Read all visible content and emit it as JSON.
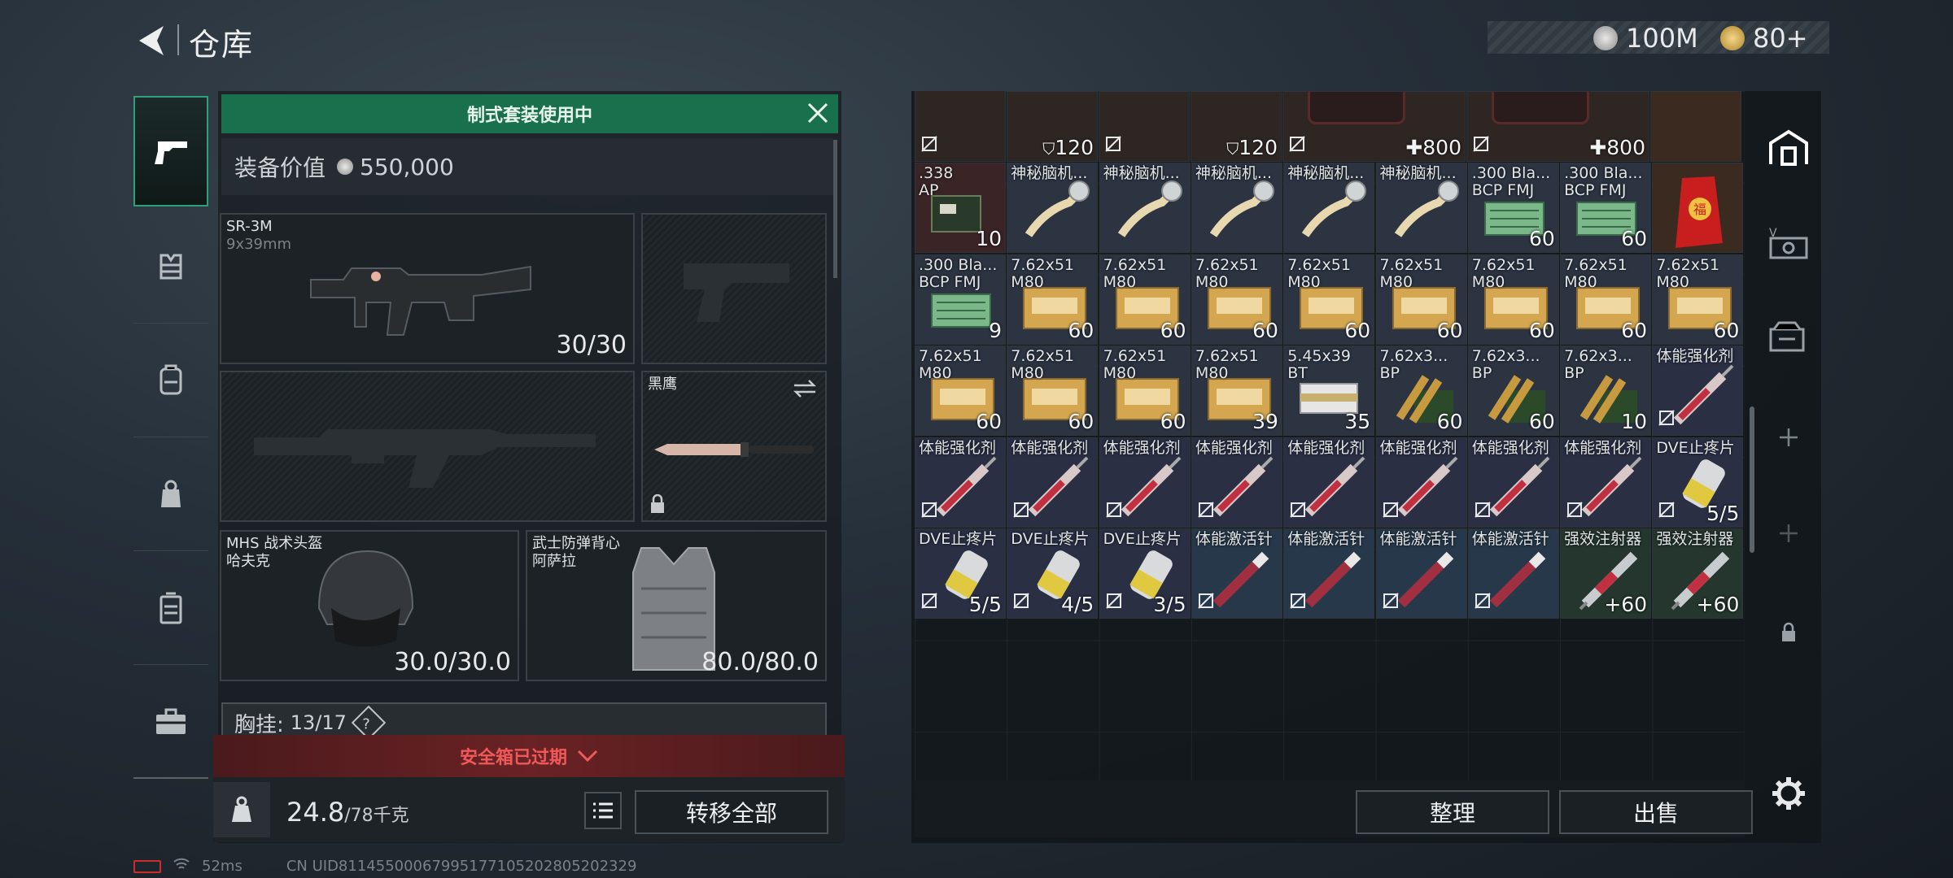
{
  "header": {
    "title": "仓库",
    "currency_1": "100M",
    "currency_2": "80+"
  },
  "loadout": {
    "set_banner": "制式套装使用中",
    "value_label": "装备价值",
    "value": "550,000",
    "primary": {
      "name": "SR-3M",
      "sub": "9x39mm",
      "count": "30/30"
    },
    "melee": {
      "name": "黑鹰"
    },
    "helmet": {
      "name": "MHS 战术头盔",
      "sub": "哈夫克",
      "count": "30.0/30.0"
    },
    "armor": {
      "name": "武士防弹背心",
      "sub": "阿萨拉",
      "count": "80.0/80.0"
    },
    "chest": {
      "label": "胸挂:",
      "count": "13/17",
      "help": "?"
    },
    "safe_box": "安全箱已过期",
    "weight": "24.8",
    "weight_max": "/78千克",
    "transfer_all": "转移全部"
  },
  "inventory": {
    "top_counts": [
      "120",
      "120",
      "800",
      "800"
    ],
    "rows": [
      [
        {
          "n": ".338",
          "n2": "AP",
          "c": "10",
          "k": "ammo-box",
          "bg": "#3a2426"
        },
        {
          "n": "神秘脑机...",
          "k": "scroll"
        },
        {
          "n": "神秘脑机...",
          "k": "scroll"
        },
        {
          "n": "神秘脑机...",
          "k": "scroll"
        },
        {
          "n": "神秘脑机...",
          "k": "scroll"
        },
        {
          "n": "神秘脑机...",
          "k": "scroll"
        },
        {
          "n": ".300 Bla...",
          "n2": "BCP FMJ",
          "c": "60",
          "k": "green-box",
          "bg": "#2c3442"
        },
        {
          "n": ".300 Bla...",
          "n2": "BCP FMJ",
          "c": "60",
          "k": "green-box",
          "bg": "#2c3442"
        },
        {
          "n": "",
          "k": "red-bag",
          "bg": "#3a2a20"
        }
      ],
      [
        {
          "n": ".300 Bla...",
          "n2": "BCP FMJ",
          "c": "9",
          "k": "green-box",
          "bg": "#2c3442"
        },
        {
          "n": "7.62x51",
          "n2": "M80",
          "c": "60",
          "k": "crate",
          "bg": "#2c3442"
        },
        {
          "n": "7.62x51",
          "n2": "M80",
          "c": "60",
          "k": "crate",
          "bg": "#2c3442"
        },
        {
          "n": "7.62x51",
          "n2": "M80",
          "c": "60",
          "k": "crate",
          "bg": "#2c3442"
        },
        {
          "n": "7.62x51",
          "n2": "M80",
          "c": "60",
          "k": "crate",
          "bg": "#2c3442"
        },
        {
          "n": "7.62x51",
          "n2": "M80",
          "c": "60",
          "k": "crate",
          "bg": "#2c3442"
        },
        {
          "n": "7.62x51",
          "n2": "M80",
          "c": "60",
          "k": "crate",
          "bg": "#2c3442"
        },
        {
          "n": "7.62x51",
          "n2": "M80",
          "c": "60",
          "k": "crate",
          "bg": "#2c3442"
        },
        {
          "n": "7.62x51",
          "n2": "M80",
          "c": "60",
          "k": "crate",
          "bg": "#2c3442"
        }
      ],
      [
        {
          "n": "7.62x51",
          "n2": "M80",
          "c": "60",
          "k": "crate",
          "bg": "#2c3442"
        },
        {
          "n": "7.62x51",
          "n2": "M80",
          "c": "60",
          "k": "crate",
          "bg": "#2c3442"
        },
        {
          "n": "7.62x51",
          "n2": "M80",
          "c": "60",
          "k": "crate",
          "bg": "#2c3442"
        },
        {
          "n": "7.62x51",
          "n2": "M80",
          "c": "39",
          "k": "crate",
          "bg": "#2c3442"
        },
        {
          "n": "5.45x39",
          "n2": "BT",
          "c": "35",
          "k": "white-box",
          "bg": "#2c3442"
        },
        {
          "n": "7.62x3...",
          "n2": "BP",
          "c": "60",
          "k": "shells",
          "bg": "#2c3442"
        },
        {
          "n": "7.62x3...",
          "n2": "BP",
          "c": "60",
          "k": "shells",
          "bg": "#2c3442"
        },
        {
          "n": "7.62x3...",
          "n2": "BP",
          "c": "10",
          "k": "shells",
          "bg": "#2c3442"
        },
        {
          "n": "体能强化剂",
          "k": "syringe",
          "bg": "#2a2f44",
          "ni": true
        }
      ],
      [
        {
          "n": "体能强化剂",
          "k": "syringe",
          "bg": "#2a2f44",
          "ni": true
        },
        {
          "n": "体能强化剂",
          "k": "syringe",
          "bg": "#2a2f44",
          "ni": true
        },
        {
          "n": "体能强化剂",
          "k": "syringe",
          "bg": "#2a2f44",
          "ni": true
        },
        {
          "n": "体能强化剂",
          "k": "syringe",
          "bg": "#2a2f44",
          "ni": true
        },
        {
          "n": "体能强化剂",
          "k": "syringe",
          "bg": "#2a2f44",
          "ni": true
        },
        {
          "n": "体能强化剂",
          "k": "syringe",
          "bg": "#2a2f44",
          "ni": true
        },
        {
          "n": "体能强化剂",
          "k": "syringe",
          "bg": "#2a2f44",
          "ni": true
        },
        {
          "n": "体能强化剂",
          "k": "syringe",
          "bg": "#2a2f44",
          "ni": true
        },
        {
          "n": "DVE止疼片",
          "c": "5/5",
          "k": "pills",
          "bg": "#2a2f44",
          "ni": true
        }
      ],
      [
        {
          "n": "DVE止疼片",
          "c": "5/5",
          "k": "pills",
          "bg": "#2a2f44",
          "ni": true
        },
        {
          "n": "DVE止疼片",
          "c": "4/5",
          "k": "pills",
          "bg": "#2a2f44",
          "ni": true
        },
        {
          "n": "DVE止疼片",
          "c": "3/5",
          "k": "pills",
          "bg": "#2a2f44",
          "ni": true
        },
        {
          "n": "体能激活针",
          "k": "pen",
          "bg": "#27384a",
          "ni": true
        },
        {
          "n": "体能激活针",
          "k": "pen",
          "bg": "#27384a",
          "ni": true
        },
        {
          "n": "体能激活针",
          "k": "pen",
          "bg": "#27384a",
          "ni": true
        },
        {
          "n": "体能激活针",
          "k": "pen",
          "bg": "#27384a",
          "ni": true
        },
        {
          "n": "强效注射器",
          "c": "+60",
          "k": "injector",
          "bg": "#24362e"
        },
        {
          "n": "强效注射器",
          "c": "+60",
          "k": "injector",
          "bg": "#24362e"
        }
      ]
    ],
    "sort": "整理",
    "sell": "出售"
  },
  "status": {
    "ping": "52ms",
    "uid": "CN UID8114550006799517710520280520232​9"
  },
  "colors": {
    "accent_green": "#18704c",
    "warning_red": "#f0595a"
  }
}
